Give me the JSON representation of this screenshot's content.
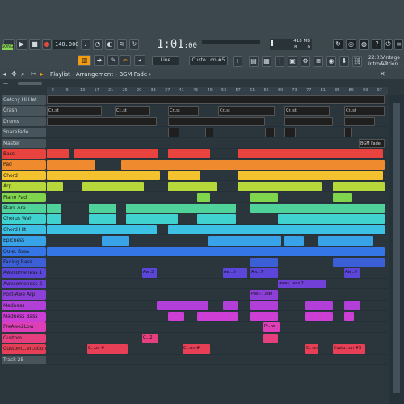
{
  "toolbar": {
    "mode_label": "SONG",
    "tempo": "140.000",
    "time": "1:01",
    "time_frac": ":00",
    "memory": "418 MB",
    "cpu_value": "8",
    "cpu_unit": "0",
    "hint_title": "Vintage Ch",
    "hint_time": "22:01",
    "hint_sub": "Introduction",
    "snap_label": "Line",
    "pattern_label": "Custo...on #5"
  },
  "playlist": {
    "title": "Playlist - Arrangement",
    "breadcrumb": "BGM Fade",
    "ruler": [
      "5",
      "9",
      "13",
      "17",
      "21",
      "25",
      "29",
      "33",
      "37",
      "41",
      "45",
      "49",
      "53",
      "57",
      "61",
      "65",
      "69",
      "73",
      "77",
      "81",
      "85",
      "89",
      "93",
      "97"
    ],
    "tracks": [
      {
        "name": "Catchy Hi Hat",
        "color": ""
      },
      {
        "name": "Crash",
        "color": ""
      },
      {
        "name": "Drums",
        "color": ""
      },
      {
        "name": "SnareFade",
        "color": ""
      },
      {
        "name": "Master",
        "color": ""
      },
      {
        "name": "Bass",
        "color": "#e8433f"
      },
      {
        "name": "Pad",
        "color": "#f08a2e"
      },
      {
        "name": "Chord",
        "color": "#f4c22f"
      },
      {
        "name": "Arp",
        "color": "#b6d83a"
      },
      {
        "name": "Piano Pad",
        "color": "#7fd64d"
      },
      {
        "name": "Stars Arp",
        "color": "#4fd39a"
      },
      {
        "name": "Chorus Wah",
        "color": "#3fd2cf"
      },
      {
        "name": "Chord Hit",
        "color": "#3cc0e3"
      },
      {
        "name": "Epicness",
        "color": "#39a3ea"
      },
      {
        "name": "Quiet Bass",
        "color": "#3476e8"
      },
      {
        "name": "Fading Bass",
        "color": "#3a5fd7"
      },
      {
        "name": "Awesomeness 1",
        "color": "#5b46d9"
      },
      {
        "name": "Awesomeness 2",
        "color": "#7040d9"
      },
      {
        "name": "Post-Awe Arp",
        "color": "#8e3fd8"
      },
      {
        "name": "Madness",
        "color": "#b13fd8"
      },
      {
        "name": "Madness Bass",
        "color": "#cc3ed4"
      },
      {
        "name": "PreAwe2Low",
        "color": "#dd3fb6"
      },
      {
        "name": "Custom",
        "color": "#e53f7e"
      },
      {
        "name": "Custom...ercution",
        "color": "#e63f56"
      },
      {
        "name": "Track 25",
        "color": ""
      }
    ],
    "clip_labels": {
      "crash": "Cr..st",
      "master": "BGM Fade",
      "awe1_a": "Aw..3",
      "awe1_b": "Aw...5",
      "awe1_c": "Aw...7",
      "awe1_d": "Aw...9",
      "awe2": "Awes...ess 2",
      "post": "Post-...ade",
      "pre": "Pr...w",
      "custom": "C...2",
      "cus_a": "C...on #",
      "cus_b": "Custo...on #5"
    }
  },
  "colors": {
    "toolbar": "#3c474e",
    "panel": "#2b363d",
    "accent_orange": "#f39c12",
    "lane": "#2a353c"
  }
}
